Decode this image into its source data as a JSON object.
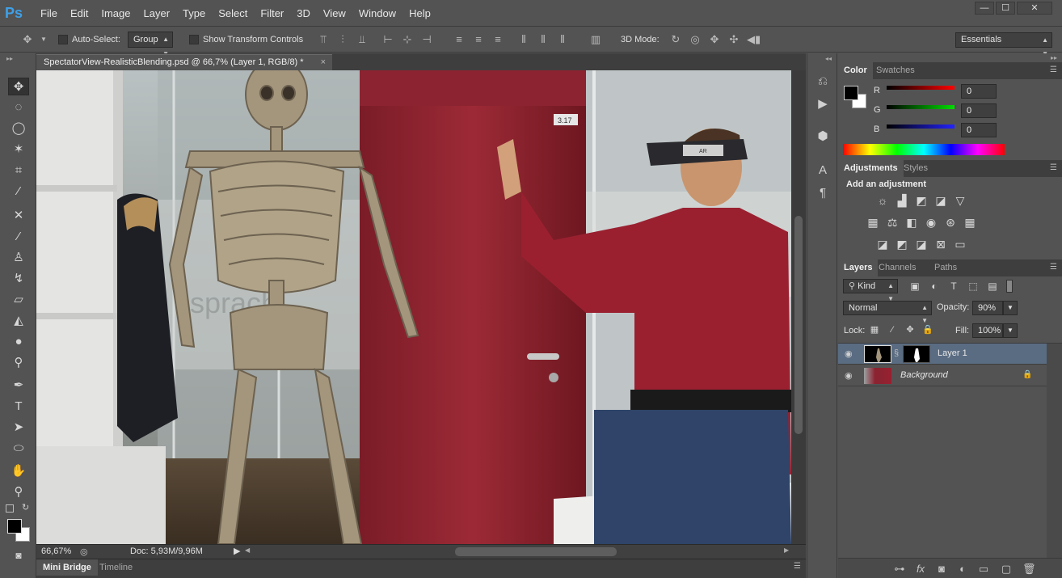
{
  "app": {
    "logo": "Ps",
    "menu": [
      "File",
      "Edit",
      "Image",
      "Layer",
      "Type",
      "Select",
      "Filter",
      "3D",
      "View",
      "Window",
      "Help"
    ],
    "window_controls": [
      "—",
      "☐",
      "✕"
    ]
  },
  "options": {
    "auto_select_label": "Auto-Select:",
    "auto_select_value": "Group",
    "show_transform_label": "Show Transform Controls",
    "mode_3d_label": "3D Mode:",
    "workspace": "Essentials"
  },
  "document": {
    "tab_title": "SpectatorView-RealisticBlending.psd @ 66,7% (Layer 1, RGB/8) *",
    "close": "×",
    "door_sign": "3.17",
    "headset_label": "AR"
  },
  "status": {
    "zoom": "66,67%",
    "doc_info": "Doc: 5,93M/9,96M"
  },
  "bottom_tabs": [
    "Mini Bridge",
    "Timeline"
  ],
  "color_panel": {
    "tabs": [
      "Color",
      "Swatches"
    ],
    "channels": [
      {
        "label": "R",
        "value": "0",
        "color": "#d42020"
      },
      {
        "label": "G",
        "value": "0",
        "color": "#20b020"
      },
      {
        "label": "B",
        "value": "0",
        "color": "#2040d4"
      }
    ]
  },
  "adjustments_panel": {
    "tabs": [
      "Adjustments",
      "Styles"
    ],
    "heading": "Add an adjustment"
  },
  "layers_panel": {
    "tabs": [
      "Layers",
      "Channels",
      "Paths"
    ],
    "kind_filter": "Kind",
    "blend_mode": "Normal",
    "opacity_label": "Opacity:",
    "opacity_value": "90%",
    "lock_label": "Lock:",
    "fill_label": "Fill:",
    "fill_value": "100%",
    "layers": [
      {
        "name": "Layer 1",
        "selected": true
      },
      {
        "name": "Background",
        "selected": false,
        "locked": true
      }
    ]
  },
  "colors": {
    "accent": "#3ea0e8",
    "panel_bg": "#535353",
    "selected_layer": "#5a6c82"
  }
}
